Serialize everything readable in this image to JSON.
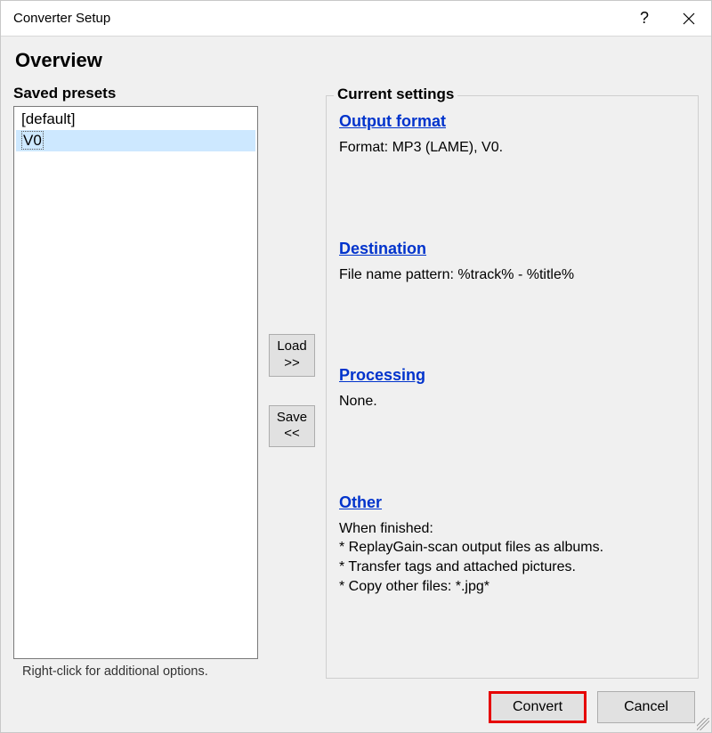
{
  "titlebar": {
    "title": "Converter Setup",
    "help_label": "?",
    "close_label": "X"
  },
  "page_title": "Overview",
  "left": {
    "heading": "Saved presets",
    "items": [
      {
        "label": "[default]",
        "selected": false
      },
      {
        "label": "V0",
        "selected": true
      }
    ],
    "hint": "Right-click for additional options."
  },
  "load_button": {
    "line1": "Load",
    "line2": ">>"
  },
  "save_button": {
    "line1": "Save",
    "line2": "<<"
  },
  "right": {
    "heading": "Current settings",
    "output_format": {
      "heading": "Output format",
      "text": "Format: MP3 (LAME), V0."
    },
    "destination": {
      "heading": "Destination",
      "text": "File name pattern: %track% - %title%"
    },
    "processing": {
      "heading": "Processing",
      "text": "None."
    },
    "other": {
      "heading": "Other",
      "lines": [
        "When finished:",
        "* ReplayGain-scan output files as albums.",
        "* Transfer tags and attached pictures.",
        "* Copy other files: *.jpg*"
      ]
    }
  },
  "buttons": {
    "convert": "Convert",
    "cancel": "Cancel"
  }
}
